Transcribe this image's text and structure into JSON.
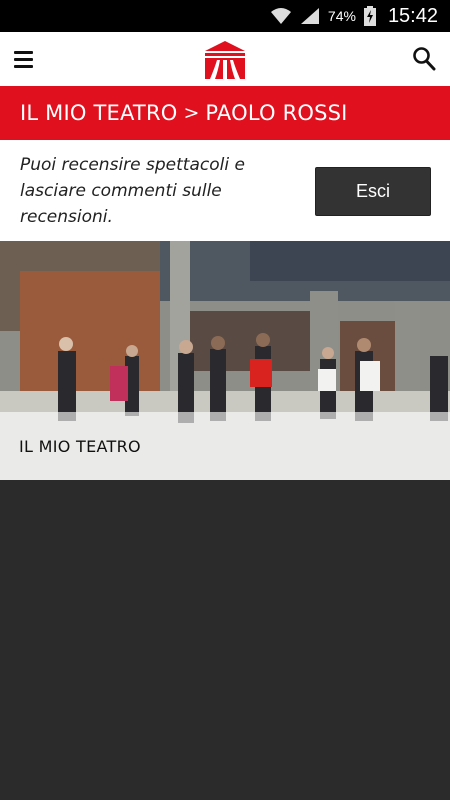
{
  "status_bar": {
    "battery_percent": "74%",
    "time": "15:42",
    "icons": [
      "wifi-icon",
      "signal-icon",
      "battery-charging-icon"
    ]
  },
  "app_bar": {
    "icons": [
      "menu-icon",
      "theatre-logo-icon",
      "search-icon"
    ],
    "brand_color": "#e0101e"
  },
  "header": {
    "section": "IL MIO TEATRO",
    "separator": ">",
    "user_name": "PAOLO ROSSI"
  },
  "info": {
    "message": "Puoi recensire spettacoli e lasciare commenti sulle recensioni.",
    "exit_label": "Esci"
  },
  "hero": {
    "caption": "IL MIO TEATRO"
  },
  "colors": {
    "accent": "#e0101e",
    "dark_button": "#333333",
    "background": "#2b2b2b"
  }
}
